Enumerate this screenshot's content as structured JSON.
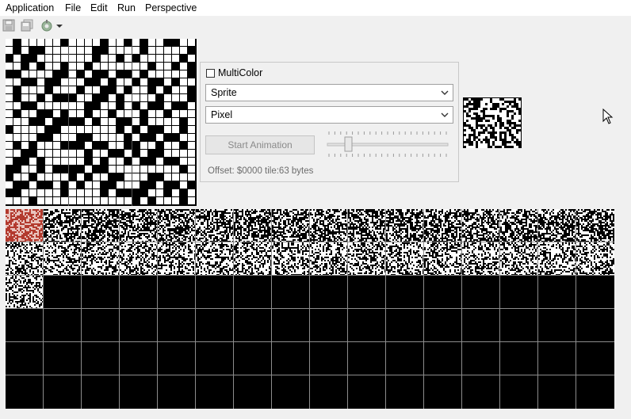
{
  "menu": [
    "Application",
    "File",
    "Edit",
    "Run",
    "Perspective"
  ],
  "toolbar": {
    "icons": [
      "save-icon",
      "save-all-icon",
      "run-config-icon",
      "dropdown-arrow-icon"
    ]
  },
  "panel": {
    "multicolor_label": "MultiColor",
    "multicolor_checked": false,
    "mode_value": "Sprite",
    "draw_value": "Pixel",
    "start_animation_label": "Start Animation",
    "offset_text": "Offset: $0000 tile:63 bytes"
  },
  "colors": {
    "background": "#f0f0f0",
    "pixel_on": "#ffffff",
    "pixel_off": "#000000",
    "selected_tile": "#b33a2e",
    "grid_lines": "#8c8c8c"
  }
}
